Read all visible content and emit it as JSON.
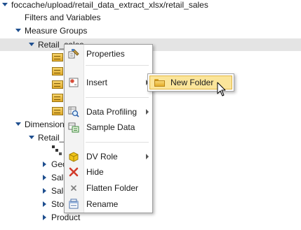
{
  "tree": {
    "root_path": "foccache/upload/retail_data_extract_xlsx/retail_sales",
    "filters_label": "Filters and Variables",
    "measure_groups_label": "Measure Groups",
    "retail_sales_label": "Retail_sales",
    "dimensions_label": "Dimension",
    "retail_dim_label": "Retail_",
    "children": [
      {
        "label": "Geo"
      },
      {
        "label": "Sale"
      },
      {
        "label": "Sale"
      },
      {
        "label": "Sto"
      },
      {
        "label": "Product"
      }
    ]
  },
  "context_menu": {
    "items": [
      {
        "label": "Properties",
        "icon": "properties-icon"
      },
      {
        "label": "Insert",
        "icon": "insert-icon",
        "has_submenu": true
      },
      {
        "label": "Data Profiling",
        "icon": "data-profiling-icon",
        "has_submenu": true
      },
      {
        "label": "Sample Data",
        "icon": "sample-data-icon"
      },
      {
        "label": "DV Role",
        "icon": "dv-role-icon",
        "has_submenu": true
      },
      {
        "label": "Hide",
        "icon": "hide-icon"
      },
      {
        "label": "Flatten Folder",
        "icon": "flatten-folder-icon"
      },
      {
        "label": "Rename",
        "icon": "rename-icon"
      }
    ]
  },
  "submenu": {
    "label": "New Folder",
    "icon": "folder-icon",
    "highlight_color": "#fbe59a"
  },
  "colors": {
    "tree_arrow": "#1f4f8f",
    "selection_row": "#e4e4e4"
  }
}
